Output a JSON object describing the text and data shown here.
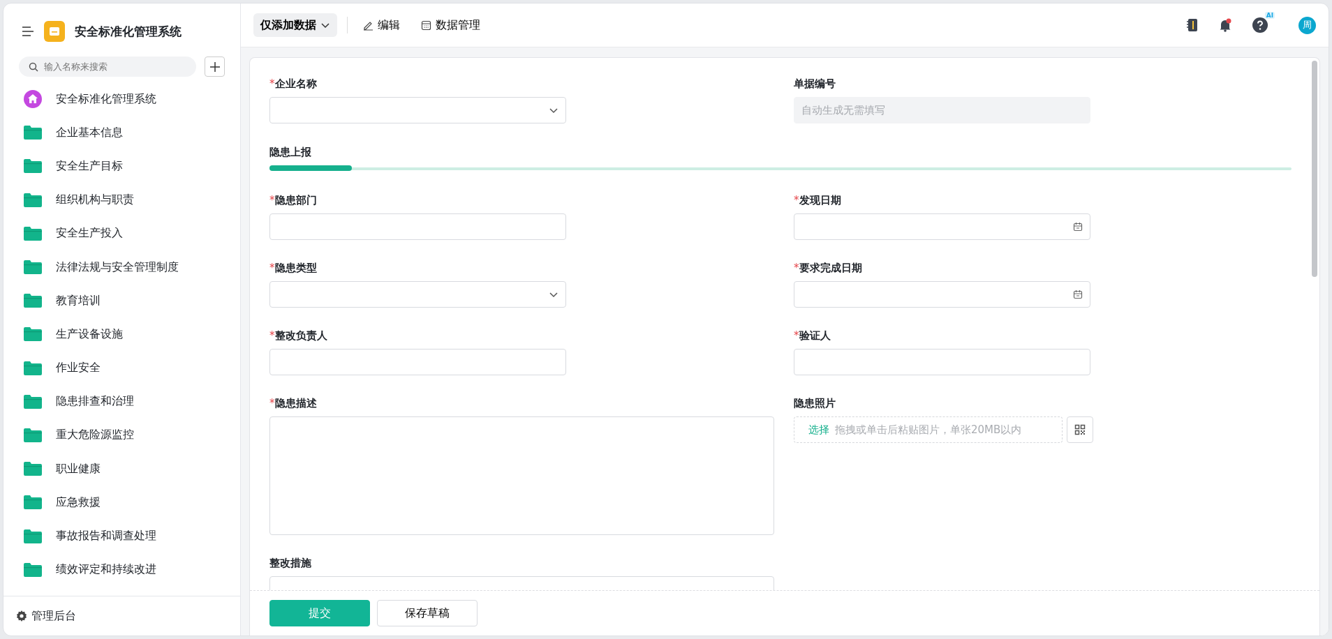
{
  "sidebar": {
    "title": "安全标准化管理系统",
    "search": {
      "placeholder": "输入名称来搜索"
    },
    "items": [
      {
        "kind": "home",
        "label": "安全标准化管理系统"
      },
      {
        "kind": "folder",
        "label": "企业基本信息"
      },
      {
        "kind": "folder",
        "label": "安全生产目标"
      },
      {
        "kind": "folder",
        "label": "组织机构与职责"
      },
      {
        "kind": "folder",
        "label": "安全生产投入"
      },
      {
        "kind": "folder",
        "label": "法律法规与安全管理制度"
      },
      {
        "kind": "folder",
        "label": "教育培训"
      },
      {
        "kind": "folder",
        "label": "生产设备设施"
      },
      {
        "kind": "folder",
        "label": "作业安全"
      },
      {
        "kind": "folder",
        "label": "隐患排查和治理"
      },
      {
        "kind": "folder",
        "label": "重大危险源监控"
      },
      {
        "kind": "folder",
        "label": "职业健康"
      },
      {
        "kind": "folder",
        "label": "应急救援"
      },
      {
        "kind": "folder",
        "label": "事故报告和调查处理"
      },
      {
        "kind": "folder",
        "label": "绩效评定和持续改进"
      }
    ],
    "footer": "管理后台"
  },
  "toolbar": {
    "mode": "仅添加数据",
    "actions": [
      {
        "kind": "edit",
        "label": "编辑"
      },
      {
        "kind": "data",
        "label": "数据管理"
      }
    ],
    "ai_badge": "AI",
    "avatar": "周"
  },
  "form": {
    "top_rows": [
      [
        {
          "kind": "select",
          "label": "企业名称",
          "required_mark": "*"
        },
        {
          "kind": "readonly",
          "label": "单据编号",
          "placeholder": "自动生成无需填写"
        }
      ]
    ],
    "section": "隐患上报",
    "rows": [
      [
        {
          "kind": "text",
          "label": "隐患部门",
          "required_mark": "*"
        },
        {
          "kind": "date",
          "label": "发现日期",
          "required_mark": "*"
        }
      ],
      [
        {
          "kind": "select",
          "label": "隐患类型",
          "required_mark": "*"
        },
        {
          "kind": "date",
          "label": "要求完成日期",
          "required_mark": "*"
        }
      ],
      [
        {
          "kind": "text",
          "label": "整改负责人",
          "required_mark": "*"
        },
        {
          "kind": "text",
          "label": "验证人",
          "required_mark": "*"
        }
      ],
      [
        {
          "kind": "textarea",
          "label": "隐患描述",
          "required_mark": "*"
        },
        {
          "kind": "upload",
          "label": "隐患照片",
          "action": "选择",
          "placeholder": "拖拽或单击后粘贴图片，单张20MB以内"
        }
      ],
      [
        {
          "kind": "textarea-cut",
          "label": "整改措施"
        }
      ]
    ],
    "buttons": [
      {
        "kind": "primary",
        "label": "提交"
      },
      {
        "kind": "secondary",
        "label": "保存草稿"
      }
    ]
  }
}
